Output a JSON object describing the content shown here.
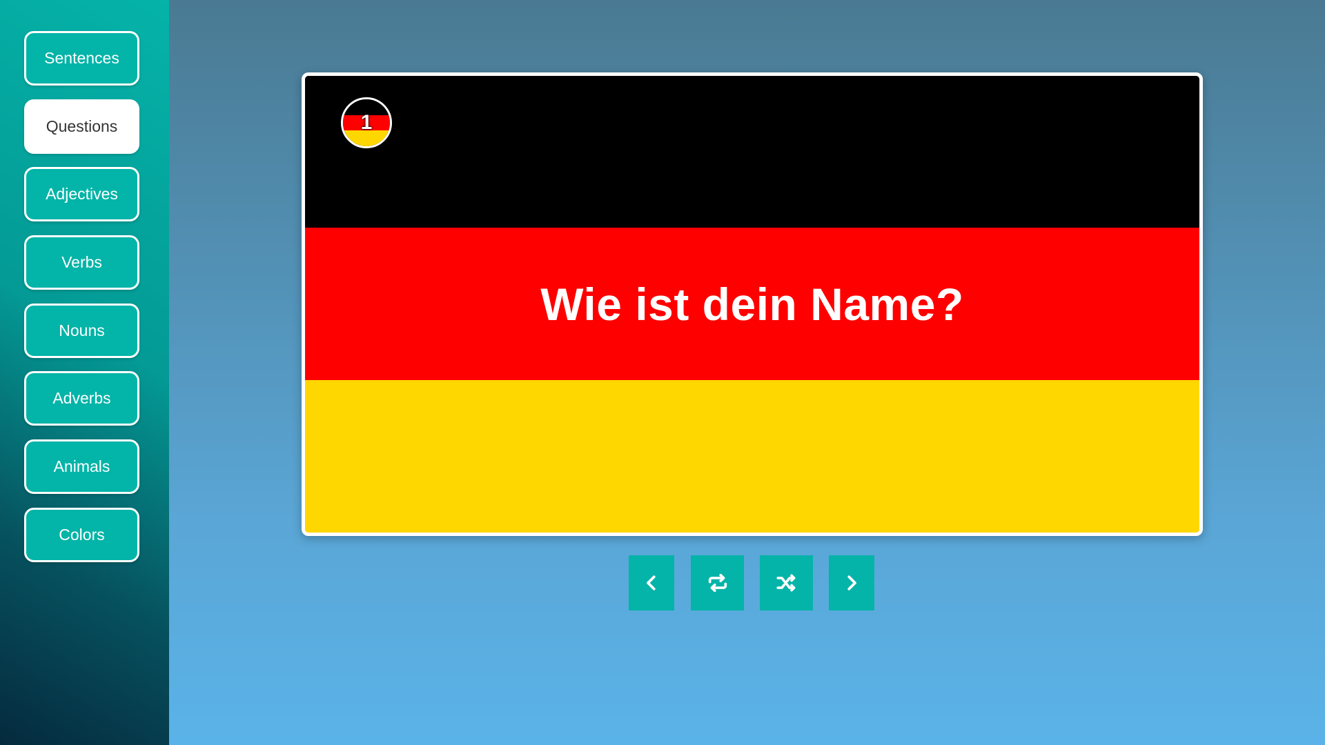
{
  "sidebar": {
    "items": [
      {
        "label": "Sentences",
        "active": false
      },
      {
        "label": "Questions",
        "active": true
      },
      {
        "label": "Adjectives",
        "active": false
      },
      {
        "label": "Verbs",
        "active": false
      },
      {
        "label": "Nouns",
        "active": false
      },
      {
        "label": "Adverbs",
        "active": false
      },
      {
        "label": "Animals",
        "active": false
      },
      {
        "label": "Colors",
        "active": false
      }
    ]
  },
  "card": {
    "number": "1",
    "phrase": "Wie ist dein Name?",
    "flag_colors": [
      "#000000",
      "#ff0000",
      "#ffd700"
    ]
  },
  "controls": {
    "previous_icon": "chevron-left-icon",
    "repeat_icon": "repeat-icon",
    "shuffle_icon": "shuffle-icon",
    "next_icon": "chevron-right-icon"
  },
  "colors": {
    "accent": "#04b4a8",
    "active_nav_bg": "#ffffff"
  }
}
